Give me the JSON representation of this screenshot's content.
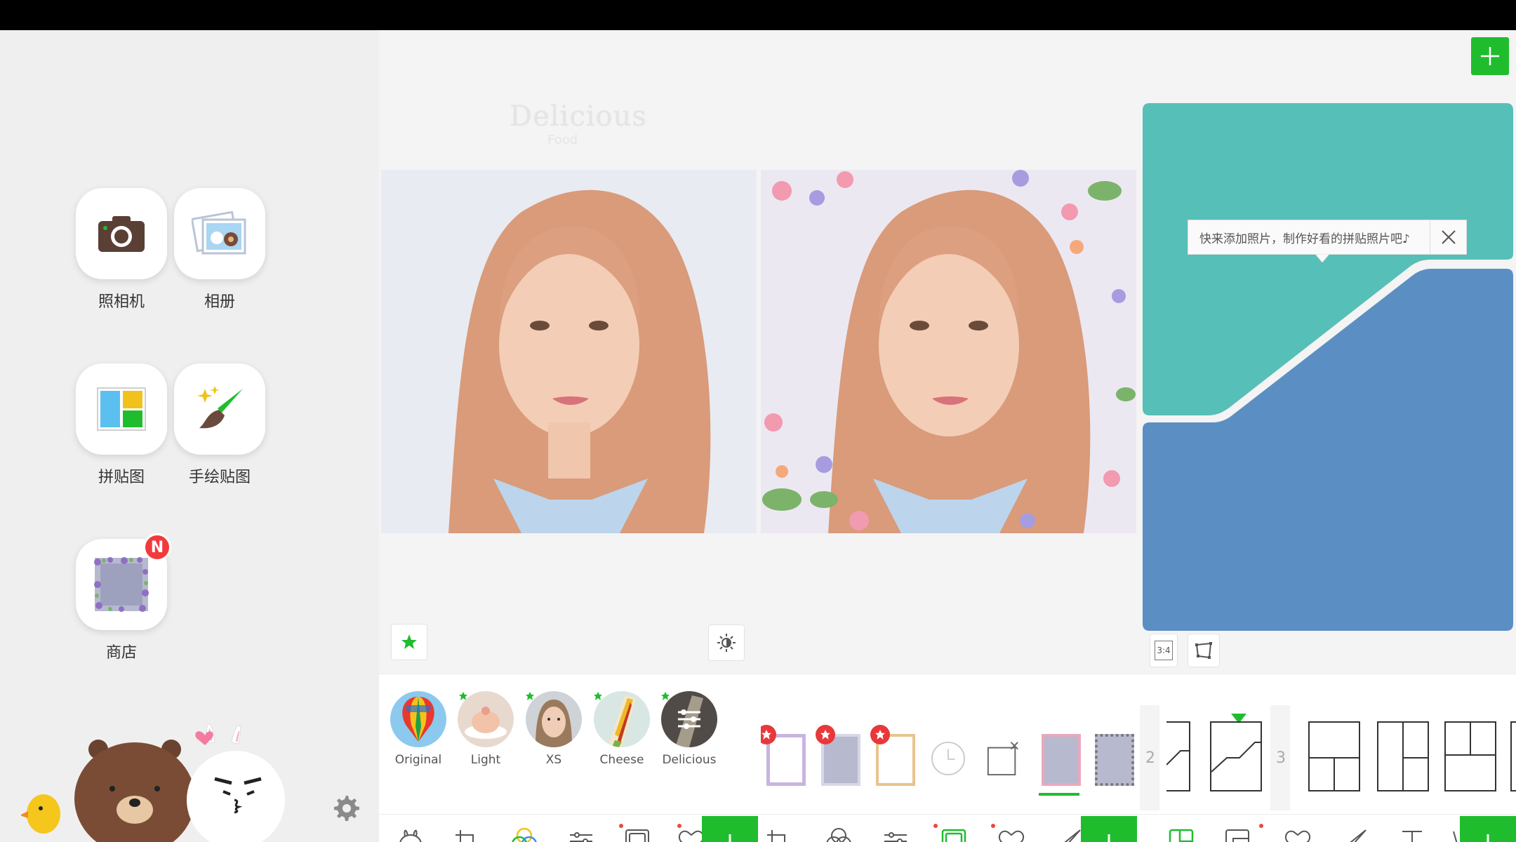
{
  "home": {
    "apps": [
      {
        "label": "照相机",
        "icon": "camera-icon"
      },
      {
        "label": "相册",
        "icon": "album-icon"
      },
      {
        "label": "拼贴图",
        "icon": "collage-icon"
      },
      {
        "label": "手绘贴图",
        "icon": "brush-icon"
      },
      {
        "label": "商店",
        "icon": "store-icon",
        "badge": "N"
      }
    ]
  },
  "editor1": {
    "watermark_title": "Delicious",
    "watermark_sub": "Food",
    "filters": [
      {
        "name": "Original"
      },
      {
        "name": "Light"
      },
      {
        "name": "XS"
      },
      {
        "name": "Cheese"
      },
      {
        "name": "Delicious"
      }
    ]
  },
  "collage": {
    "tooltip": "快来添加照片，制作好看的拼贴照片吧♪",
    "ratio": "3:4",
    "layout_groups": [
      "2",
      "3"
    ]
  },
  "colors": {
    "accent": "#1fbd2e",
    "badge": "#f2393c",
    "cell_teal": "#56bfb7",
    "cell_blue": "#5b8fc4"
  }
}
